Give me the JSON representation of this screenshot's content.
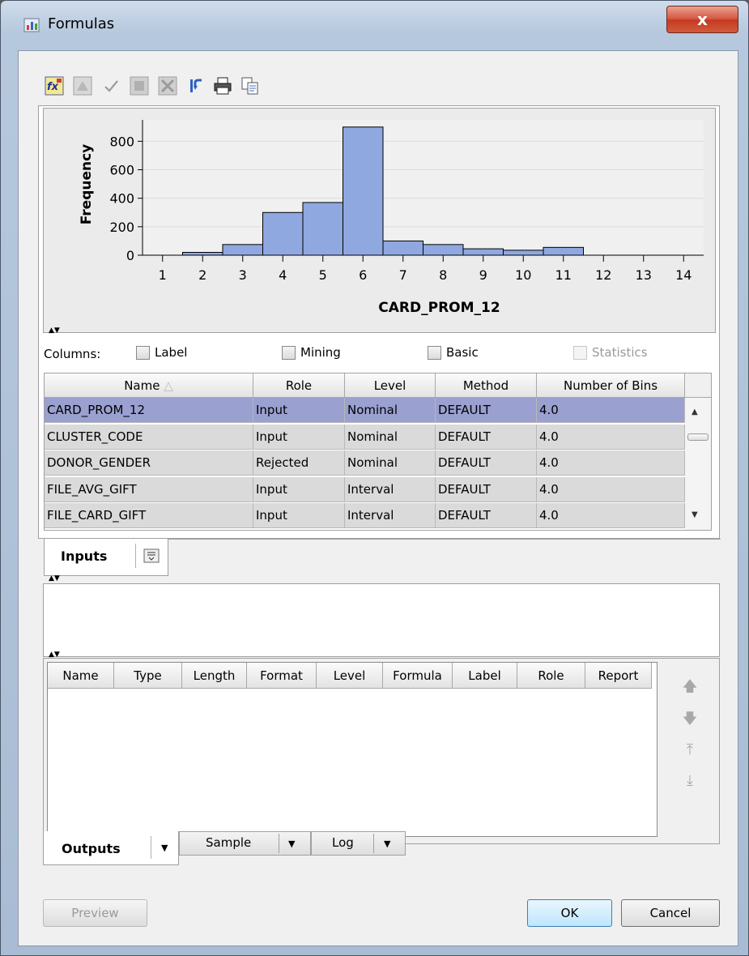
{
  "window": {
    "title": "Formulas",
    "close_glyph": "x"
  },
  "toolbar": {
    "icons": [
      "formula-builder-icon",
      "edit-formula-icon",
      "check-icon",
      "delete-formula-icon",
      "clear-icon",
      "undo-icon",
      "print-icon",
      "copy-icon"
    ]
  },
  "chart_data": {
    "type": "bar",
    "categories": [
      "2",
      "3",
      "4",
      "5",
      "6",
      "7",
      "8",
      "9",
      "10",
      "11"
    ],
    "values": [
      20,
      75,
      300,
      370,
      900,
      100,
      75,
      45,
      35,
      55
    ],
    "xticks": [
      "1",
      "2",
      "3",
      "4",
      "5",
      "6",
      "7",
      "8",
      "9",
      "10",
      "11",
      "12",
      "13",
      "14"
    ],
    "yticks": [
      "0",
      "200",
      "400",
      "600",
      "800"
    ],
    "xlim": [
      0.5,
      14.5
    ],
    "ylim": [
      0,
      950
    ],
    "xlabel": "CARD_PROM_12",
    "ylabel": "Frequency",
    "grid": true,
    "bar_color": "#8fa8e0"
  },
  "columns_bar": {
    "label": "Columns:",
    "options": [
      {
        "label": "Label",
        "checked": false,
        "enabled": true
      },
      {
        "label": "Mining",
        "checked": false,
        "enabled": true
      },
      {
        "label": "Basic",
        "checked": false,
        "enabled": true
      },
      {
        "label": "Statistics",
        "checked": false,
        "enabled": false
      }
    ]
  },
  "inputs_table": {
    "headers": [
      "Name",
      "Role",
      "Level",
      "Method",
      "Number of Bins"
    ],
    "sort_indicator": "△",
    "rows": [
      [
        "CARD_PROM_12",
        "Input",
        "Nominal",
        "DEFAULT",
        "4.0"
      ],
      [
        "CLUSTER_CODE",
        "Input",
        "Nominal",
        "DEFAULT",
        "4.0"
      ],
      [
        "DONOR_GENDER",
        "Rejected",
        "Nominal",
        "DEFAULT",
        "4.0"
      ],
      [
        "FILE_AVG_GIFT",
        "Input",
        "Interval",
        "DEFAULT",
        "4.0"
      ],
      [
        "FILE_CARD_GIFT",
        "Input",
        "Interval",
        "DEFAULT",
        "4.0"
      ]
    ],
    "selected_row": 0
  },
  "inputs_tab": {
    "label": "Inputs"
  },
  "outputs_table": {
    "headers": [
      "Name",
      "Type",
      "Length",
      "Format",
      "Level",
      "Formula",
      "Label",
      "Role",
      "Report"
    ]
  },
  "bottom_tabs": [
    {
      "label": "Outputs",
      "active": true
    },
    {
      "label": "Sample",
      "active": false
    },
    {
      "label": "Log",
      "active": false
    }
  ],
  "buttons": {
    "preview": "Preview",
    "ok": "OK",
    "cancel": "Cancel"
  }
}
